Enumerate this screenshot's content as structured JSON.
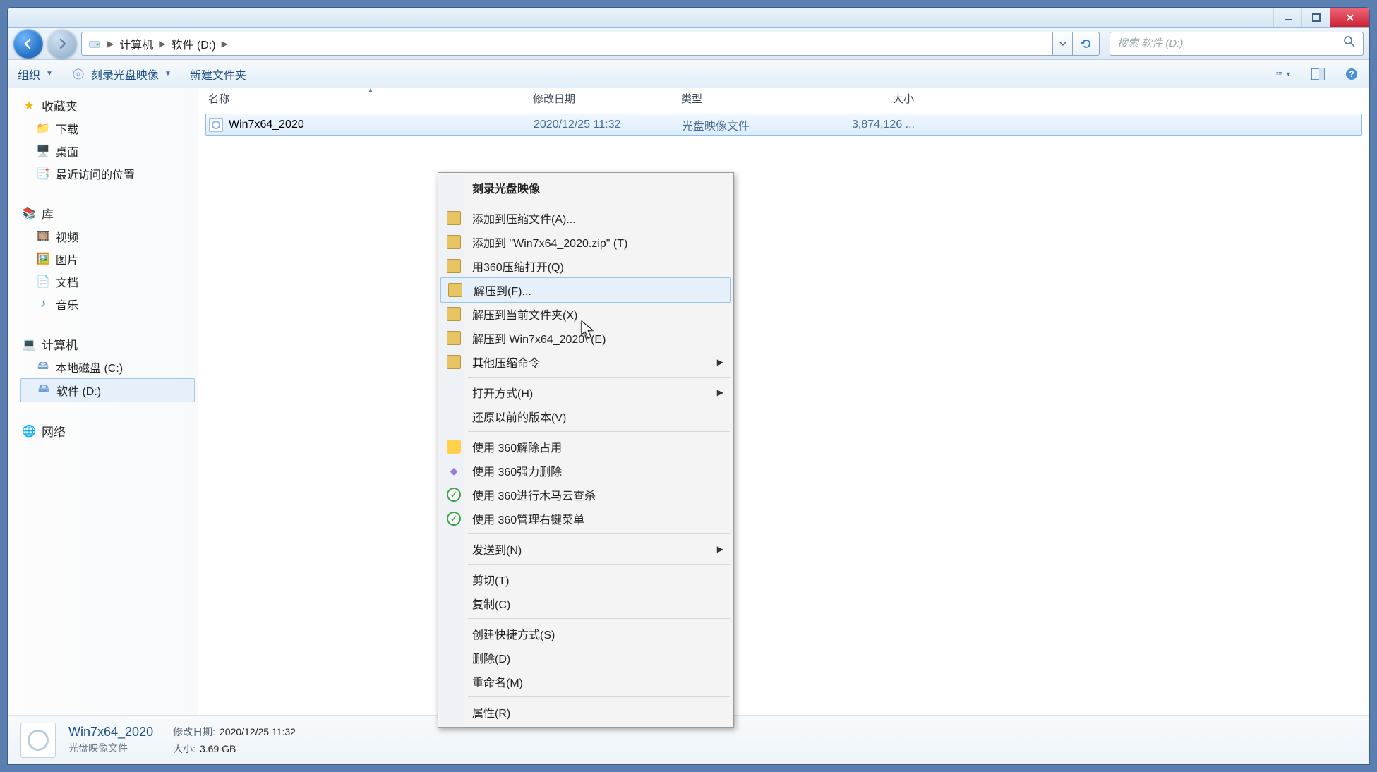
{
  "window": {
    "breadcrumbs": [
      "计算机",
      "软件 (D:)"
    ],
    "search_placeholder": "搜索 软件 (D:)"
  },
  "toolbar": {
    "organize": "组织",
    "burn": "刻录光盘映像",
    "new_folder": "新建文件夹"
  },
  "sidebar": {
    "favorites": {
      "label": "收藏夹",
      "items": [
        "下载",
        "桌面",
        "最近访问的位置"
      ]
    },
    "libraries": {
      "label": "库",
      "items": [
        "视频",
        "图片",
        "文档",
        "音乐"
      ]
    },
    "computer": {
      "label": "计算机",
      "items": [
        "本地磁盘 (C:)",
        "软件 (D:)"
      ],
      "selected_index": 1
    },
    "network": {
      "label": "网络"
    }
  },
  "columns": {
    "name": "名称",
    "date": "修改日期",
    "type": "类型",
    "size": "大小"
  },
  "files": [
    {
      "name": "Win7x64_2020",
      "date": "2020/12/25 11:32",
      "type": "光盘映像文件",
      "size": "3,874,126 ..."
    }
  ],
  "context_menu": {
    "burn": "刻录光盘映像",
    "items_archive": [
      "添加到压缩文件(A)...",
      "添加到 \"Win7x64_2020.zip\" (T)",
      "用360压缩打开(Q)",
      "解压到(F)...",
      "解压到当前文件夹(X)",
      "解压到 Win7x64_2020\\ (E)",
      "其他压缩命令"
    ],
    "hover_index": 3,
    "open_with": "打开方式(H)",
    "restore": "还原以前的版本(V)",
    "sec_items": [
      "使用 360解除占用",
      "使用 360强力删除",
      "使用 360进行木马云查杀",
      "使用 360管理右键菜单"
    ],
    "send_to": "发送到(N)",
    "edit_items": [
      "剪切(T)",
      "复制(C)"
    ],
    "file_items": [
      "创建快捷方式(S)",
      "删除(D)",
      "重命名(M)"
    ],
    "properties": "属性(R)"
  },
  "details": {
    "name": "Win7x64_2020",
    "type": "光盘映像文件",
    "date_label": "修改日期:",
    "date": "2020/12/25 11:32",
    "size_label": "大小:",
    "size": "3.69 GB"
  }
}
